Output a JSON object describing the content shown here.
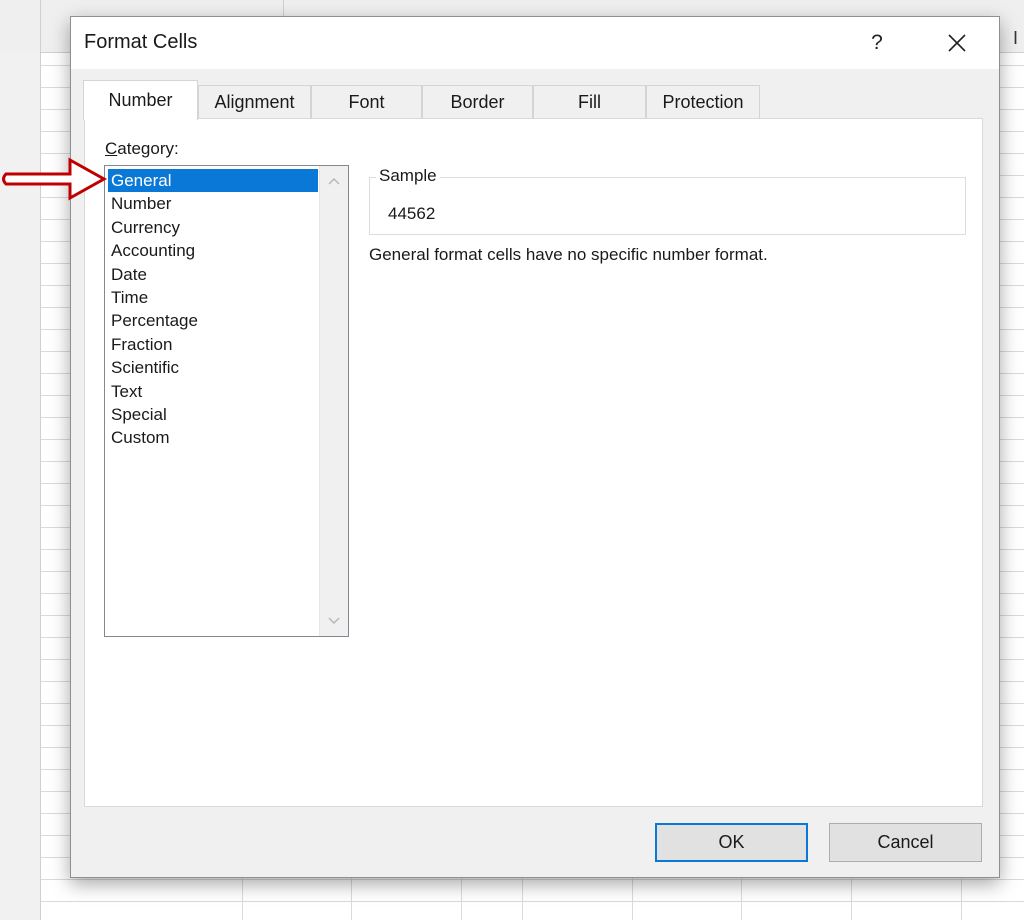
{
  "spreadsheet": {
    "partial_column_letter": "I"
  },
  "dialog": {
    "title": "Format Cells",
    "help_label": "?",
    "tabs": [
      {
        "label": "Number",
        "active": true
      },
      {
        "label": "Alignment",
        "active": false
      },
      {
        "label": "Font",
        "active": false
      },
      {
        "label": "Border",
        "active": false
      },
      {
        "label": "Fill",
        "active": false
      },
      {
        "label": "Protection",
        "active": false
      }
    ],
    "category": {
      "label_prefix": "C",
      "label_rest": "ategory:",
      "items": [
        "General",
        "Number",
        "Currency",
        "Accounting",
        "Date",
        "Time",
        "Percentage",
        "Fraction",
        "Scientific",
        "Text",
        "Special",
        "Custom"
      ],
      "selected": "General"
    },
    "sample": {
      "legend": "Sample",
      "value": "44562"
    },
    "description": "General format cells have no specific number format.",
    "buttons": {
      "ok": "OK",
      "cancel": "Cancel"
    }
  },
  "colors": {
    "selection": "#0a78d7",
    "annotation_arrow": "#c00000",
    "default_button_border": "#0a78d7"
  },
  "icons": [
    "close-icon",
    "scroll-up-arrow-icon",
    "scroll-down-arrow-icon",
    "annotation-arrow-icon"
  ]
}
